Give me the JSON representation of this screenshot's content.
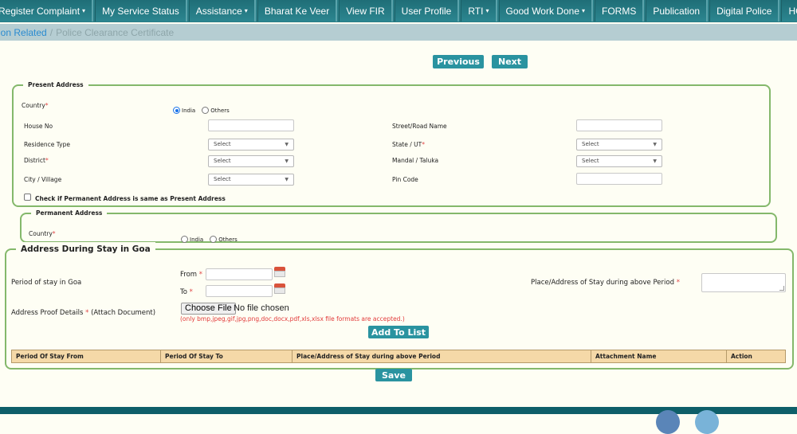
{
  "nav": {
    "items": [
      {
        "label": "Register Complaint",
        "dropdown": true
      },
      {
        "label": "My Service Status",
        "dropdown": false
      },
      {
        "label": "Assistance",
        "dropdown": true
      },
      {
        "label": "Bharat Ke Veer",
        "dropdown": false
      },
      {
        "label": "View FIR",
        "dropdown": false
      },
      {
        "label": "User Profile",
        "dropdown": false
      },
      {
        "label": "RTI",
        "dropdown": true
      },
      {
        "label": "Good Work Done",
        "dropdown": true
      },
      {
        "label": "FORMS",
        "dropdown": false
      },
      {
        "label": "Publication",
        "dropdown": false
      },
      {
        "label": "Digital Police",
        "dropdown": false
      },
      {
        "label": "HG & CD",
        "dropdown": true
      }
    ],
    "caret_glyph": "▾"
  },
  "breadcrumb": {
    "parent": "ion Related",
    "separator": "/",
    "current": "Police Clearance Certificate"
  },
  "pager": {
    "previous_label": "Previous",
    "next_label": "Next"
  },
  "present_address": {
    "legend": "Present Address",
    "country_label": "Country",
    "required_mark": "*",
    "country_options": [
      {
        "label": "India",
        "selected": true
      },
      {
        "label": "Others",
        "selected": false
      }
    ],
    "house_no_label": "House No",
    "house_no_value": "",
    "street_label": "Street/Road Name",
    "street_value": "",
    "residence_type_label": "Residence Type",
    "residence_type_value": "Select",
    "state_label": "State / UT",
    "state_value": "Select",
    "district_label": "District",
    "district_value": "Select",
    "mandal_label": "Mandal / Taluka",
    "mandal_value": "Select",
    "city_label": "City / Village",
    "city_value": "Select",
    "pincode_label": "Pin Code",
    "pincode_value": "",
    "same_as_label": "Check if Permanent Address is same as Present Address",
    "same_as_checked": false
  },
  "permanent_address": {
    "legend": "Permanent Address",
    "country_label": "Country",
    "country_options": [
      {
        "label": "India",
        "selected": false
      },
      {
        "label": "Others",
        "selected": false
      }
    ]
  },
  "goa_stay": {
    "legend": "Address During Stay in Goa",
    "period_label": "Period of stay in Goa",
    "from_label": "From",
    "to_label": "To",
    "required_mark": "*",
    "from_value": "",
    "to_value": "",
    "place_label": "Place/Address of Stay during above Period",
    "place_value": "",
    "proof_label": "Address Proof Details",
    "proof_suffix": "(Attach Document)",
    "choose_file_label": "Choose File",
    "no_file_text": "No file chosen",
    "formats_hint": "(only bmp,jpeg,gif,jpg,png,doc,docx,pdf,xls,xlsx file formats are accepted.)",
    "add_to_list_label": "Add To List",
    "table_headers": [
      "Period Of Stay From",
      "Period Of Stay To",
      "Place/Address of Stay during above Period",
      "Attachment Name",
      "Action"
    ],
    "table_rows": []
  },
  "save_label": "Save",
  "colors": {
    "nav_bg": "#2a7d86",
    "button_bg": "#2a93a0",
    "fieldset_border": "#84b86b",
    "table_header_bg": "#f5d9a8",
    "required": "#e04545",
    "footer_bg": "#0e5f69"
  }
}
